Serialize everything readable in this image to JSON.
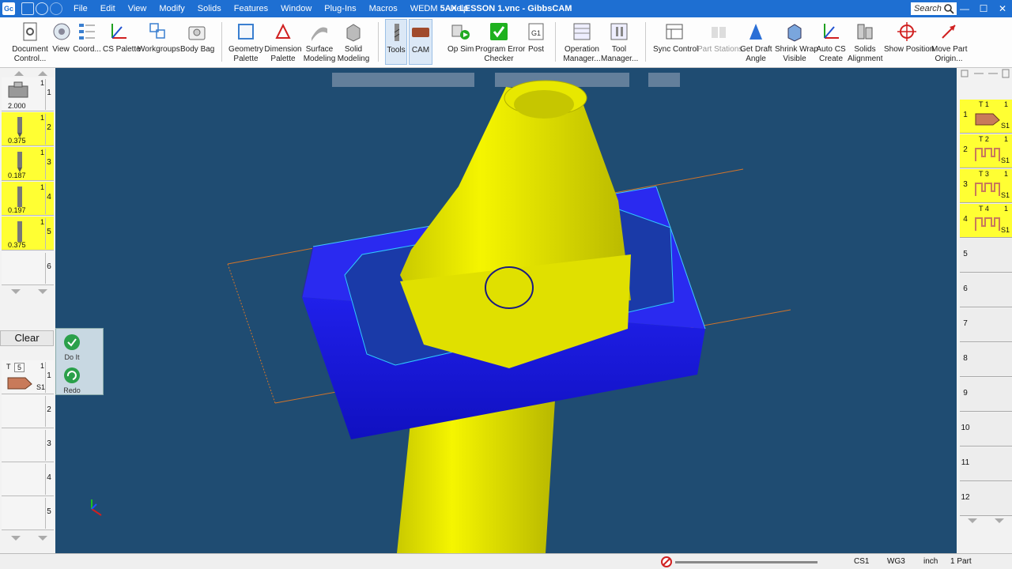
{
  "window": {
    "title": "5AX LESSON 1.vnc - GibbsCAM",
    "app_badge": "Gc"
  },
  "menu": [
    "File",
    "Edit",
    "View",
    "Modify",
    "Solids",
    "Features",
    "Window",
    "Plug-Ins",
    "Macros",
    "WEDM",
    "Help"
  ],
  "search": {
    "placeholder": "Search"
  },
  "toolbar": {
    "document_control": [
      "Document",
      "Control..."
    ],
    "view": "View",
    "coord": "Coord...",
    "cs_palette": "CS Palette",
    "workgroups": "Workgroups",
    "body_bag": "Body Bag",
    "geometry_palette": [
      "Geometry",
      "Palette"
    ],
    "dimension_palette": [
      "Dimension",
      "Palette"
    ],
    "surface_modeling": [
      "Surface",
      "Modeling"
    ],
    "solid_modeling": [
      "Solid",
      "Modeling"
    ],
    "tools": "Tools",
    "cam": "CAM",
    "op_sim": "Op Sim",
    "program_error_checker": [
      "Program Error",
      "Checker"
    ],
    "post": "Post",
    "operation_manager": [
      "Operation",
      "Manager..."
    ],
    "tool_manager": [
      "Tool",
      "Manager..."
    ],
    "sync_control": "Sync Control",
    "part_stations": "Part Stations",
    "get_draft_angle": [
      "Get Draft",
      "Angle"
    ],
    "shrink_wrap_visible": [
      "Shrink Wrap",
      "Visible"
    ],
    "auto_cs_create": [
      "Auto CS",
      "Create"
    ],
    "solids_alignment": [
      "Solids",
      "Alignment"
    ],
    "show_position": "Show Position",
    "move_part_origin": [
      "Move Part",
      "Origin..."
    ]
  },
  "tool_list": [
    {
      "slot": "1",
      "value": "2.000",
      "highlight": false
    },
    {
      "slot": "2",
      "value": "0.375",
      "highlight": true
    },
    {
      "slot": "3",
      "value": "0.187",
      "highlight": true
    },
    {
      "slot": "4",
      "value": "0.197",
      "highlight": true
    },
    {
      "slot": "5",
      "value": "0.375",
      "highlight": true
    },
    {
      "slot": "6",
      "value": "",
      "highlight": false
    }
  ],
  "clear_label": "Clear",
  "op_panel": {
    "do_it": "Do It",
    "redo": "Redo"
  },
  "process_list": [
    {
      "slot": "1",
      "tool": "T",
      "tool_num": "5",
      "s": "S1",
      "count": "1"
    },
    {
      "slot": "2"
    },
    {
      "slot": "3"
    },
    {
      "slot": "4"
    },
    {
      "slot": "5"
    }
  ],
  "operation_list": [
    {
      "slot": "1",
      "t": "T 1",
      "s": "S1",
      "count": "1"
    },
    {
      "slot": "2",
      "t": "T 2",
      "s": "S1",
      "count": "1"
    },
    {
      "slot": "3",
      "t": "T 3",
      "s": "S1",
      "count": "1"
    },
    {
      "slot": "4",
      "t": "T 4",
      "s": "S1",
      "count": "1"
    },
    {
      "slot": "5"
    },
    {
      "slot": "6"
    },
    {
      "slot": "7"
    },
    {
      "slot": "8"
    },
    {
      "slot": "9"
    },
    {
      "slot": "10"
    },
    {
      "slot": "11"
    },
    {
      "slot": "12"
    }
  ],
  "status": {
    "cs": "CS1",
    "wg": "WG3",
    "units": "inch",
    "parts": "1 Part"
  },
  "colors": {
    "viewport_bg": "#1f4c72",
    "part_yellow": "#f5f500",
    "stock_blue": "#1c1ce0",
    "titlebar": "#1e6fd2"
  }
}
